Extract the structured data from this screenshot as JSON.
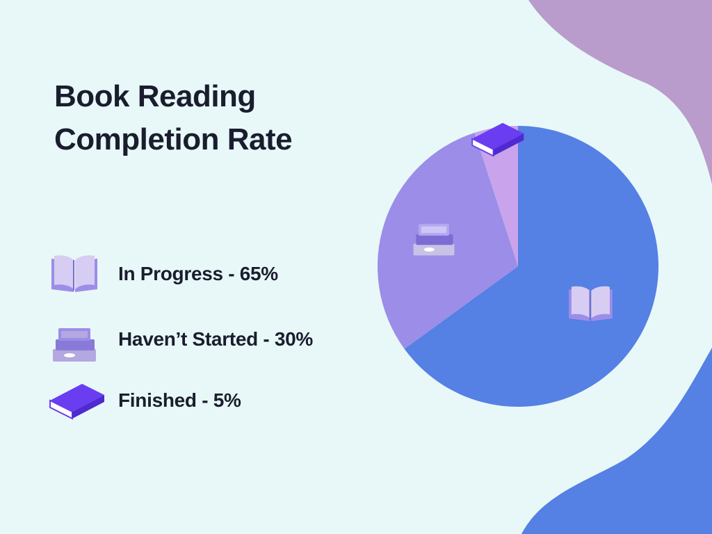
{
  "title_lines": [
    "Book Reading",
    "Completion Rate"
  ],
  "colors": {
    "background": "#e8f8f9",
    "blob_top": "#b99ccb",
    "blob_bottom": "#5580e4",
    "in_progress": "#5580e4",
    "havent_started": "#9b8de8",
    "finished": "#c9a3ec",
    "text": "#1a1d2e"
  },
  "legend": [
    {
      "label": "In Progress - 65%",
      "icon": "open-book-icon"
    },
    {
      "label": "Haven’t Started - 30%",
      "icon": "book-stack-icon"
    },
    {
      "label": "Finished - 5%",
      "icon": "closed-book-icon"
    }
  ],
  "chart_data": {
    "type": "pie",
    "title": "Book Reading Completion Rate",
    "slices": [
      {
        "label": "In Progress",
        "value": 65,
        "color": "#5580e4",
        "icon": "open-book-icon"
      },
      {
        "label": "Haven’t Started",
        "value": 30,
        "color": "#9b8de8",
        "icon": "book-stack-icon"
      },
      {
        "label": "Finished",
        "value": 5,
        "color": "#c9a3ec",
        "icon": "closed-book-icon"
      }
    ],
    "legend_position": "left"
  }
}
